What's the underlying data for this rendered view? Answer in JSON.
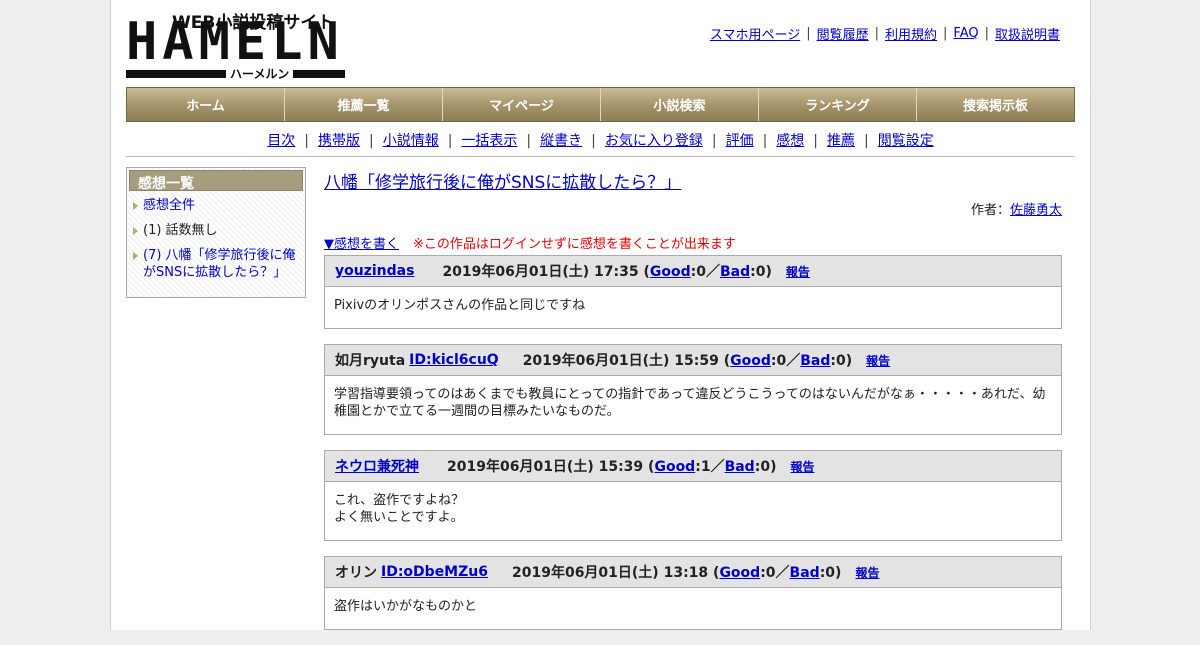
{
  "logo": {
    "tagline": "WEB小説投稿サイト",
    "brand": "HAMELN",
    "kana": "ハーメルン"
  },
  "top_links": [
    "スマホ用ページ",
    "閲覧履歴",
    "利用規約",
    "FAQ",
    "取扱説明書"
  ],
  "main_nav": [
    "ホーム",
    "推薦一覧",
    "マイページ",
    "小説検索",
    "ランキング",
    "捜索掲示板"
  ],
  "sub_nav": [
    "目次",
    "携帯版",
    "小説情報",
    "一括表示",
    "縦書き",
    "お気に入り登録",
    "評価",
    "感想",
    "推薦",
    "閲覧設定"
  ],
  "sidebar": {
    "title": "感想一覧",
    "items": [
      {
        "label": "感想全件",
        "link": true
      },
      {
        "label": "(1) 話数無し",
        "link": false
      },
      {
        "label": "(7) 八幡「修学旅行後に俺がSNSに拡散したら？」",
        "link": true
      }
    ]
  },
  "novel": {
    "title": "八幡「修学旅行後に俺がSNSに拡散したら？」",
    "author_label": "作者：",
    "author": "佐藤勇太",
    "write_link": "▼感想を書く",
    "notice": "※この作品はログインせずに感想を書くことが出来ます"
  },
  "labels": {
    "good": "Good",
    "bad": "Bad",
    "report": "報告"
  },
  "reviews": [
    {
      "name": "youzindas",
      "name_is_link": true,
      "id": "",
      "date": "2019年06月01日(土) 17:35",
      "good": "0",
      "bad": "0",
      "lines": [
        "Pixivのオリンポスさんの作品と同じですね"
      ]
    },
    {
      "name": "如月ryuta",
      "name_is_link": false,
      "id": "ID:kicl6cuQ",
      "date": "2019年06月01日(土) 15:59",
      "good": "0",
      "bad": "0",
      "lines": [
        "学習指導要領ってのはあくまでも教員にとっての指針であって違反どうこうってのはないんだがなぁ・・・・・あれだ、幼稚園とかで立てる一週間の目標みたいなものだ。"
      ]
    },
    {
      "name": "ネウロ兼死神",
      "name_is_link": true,
      "id": "",
      "date": "2019年06月01日(土) 15:39",
      "good": "1",
      "bad": "0",
      "lines": [
        "これ、盗作ですよね？",
        "よく無いことですよ。"
      ]
    },
    {
      "name": "オリン",
      "name_is_link": false,
      "id": "ID:oDbeMZu6",
      "date": "2019年06月01日(土) 13:18",
      "good": "0",
      "bad": "0",
      "lines": [
        "盗作はいかがなものかと"
      ]
    }
  ]
}
